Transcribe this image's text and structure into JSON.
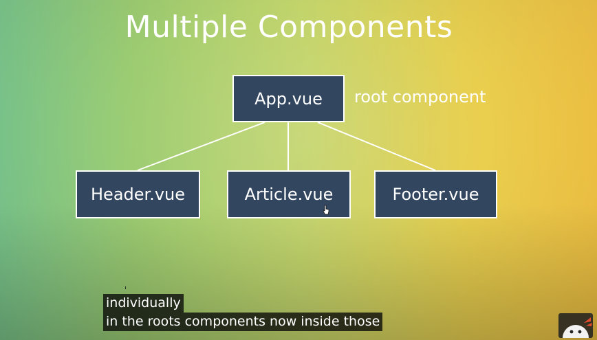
{
  "slide": {
    "title": "Multiple Components",
    "root_label": "root component",
    "boxes": {
      "app": "App.vue",
      "header": "Header.vue",
      "article": "Article.vue",
      "footer": "Footer.vue"
    }
  },
  "captions": {
    "line1": "individually",
    "line2": "in the roots components now inside those"
  },
  "icons": {
    "cursor": "hand-pointer-icon",
    "watermark": "channel-logo-icon"
  },
  "colors": {
    "box_fill": "#33465f",
    "box_border": "#ffffff",
    "text": "#ffffff",
    "caption_bg": "#080808"
  }
}
